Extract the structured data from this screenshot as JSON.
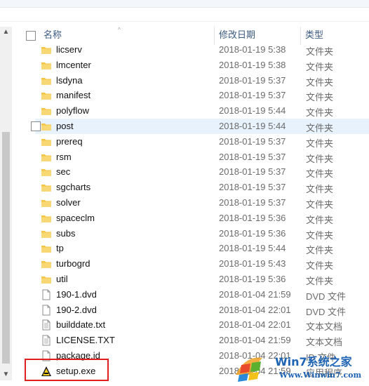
{
  "header": {
    "name": "名称",
    "date": "修改日期",
    "type": "类型"
  },
  "rows": [
    {
      "name": "licserv",
      "date": "2018-01-19 5:38",
      "type": "文件夹",
      "icon": "folder-icon"
    },
    {
      "name": "lmcenter",
      "date": "2018-01-19 5:38",
      "type": "文件夹",
      "icon": "folder-icon"
    },
    {
      "name": "lsdyna",
      "date": "2018-01-19 5:37",
      "type": "文件夹",
      "icon": "folder-icon"
    },
    {
      "name": "manifest",
      "date": "2018-01-19 5:37",
      "type": "文件夹",
      "icon": "folder-icon"
    },
    {
      "name": "polyflow",
      "date": "2018-01-19 5:44",
      "type": "文件夹",
      "icon": "folder-icon"
    },
    {
      "name": "post",
      "date": "2018-01-19 5:44",
      "type": "文件夹",
      "icon": "folder-icon",
      "hover": true
    },
    {
      "name": "prereq",
      "date": "2018-01-19 5:37",
      "type": "文件夹",
      "icon": "folder-icon"
    },
    {
      "name": "rsm",
      "date": "2018-01-19 5:37",
      "type": "文件夹",
      "icon": "folder-icon"
    },
    {
      "name": "sec",
      "date": "2018-01-19 5:37",
      "type": "文件夹",
      "icon": "folder-icon"
    },
    {
      "name": "sgcharts",
      "date": "2018-01-19 5:37",
      "type": "文件夹",
      "icon": "folder-icon"
    },
    {
      "name": "solver",
      "date": "2018-01-19 5:37",
      "type": "文件夹",
      "icon": "folder-icon"
    },
    {
      "name": "spaceclm",
      "date": "2018-01-19 5:36",
      "type": "文件夹",
      "icon": "folder-icon"
    },
    {
      "name": "subs",
      "date": "2018-01-19 5:36",
      "type": "文件夹",
      "icon": "folder-icon"
    },
    {
      "name": "tp",
      "date": "2018-01-19 5:44",
      "type": "文件夹",
      "icon": "folder-icon"
    },
    {
      "name": "turbogrd",
      "date": "2018-01-19 5:43",
      "type": "文件夹",
      "icon": "folder-icon"
    },
    {
      "name": "util",
      "date": "2018-01-19 5:36",
      "type": "文件夹",
      "icon": "folder-icon"
    },
    {
      "name": "190-1.dvd",
      "date": "2018-01-04 21:59",
      "type": "DVD 文件",
      "icon": "file-icon"
    },
    {
      "name": "190-2.dvd",
      "date": "2018-01-04 22:01",
      "type": "DVD 文件",
      "icon": "file-icon"
    },
    {
      "name": "builddate.txt",
      "date": "2018-01-04 22:01",
      "type": "文本文档",
      "icon": "text-file-icon"
    },
    {
      "name": "LICENSE.TXT",
      "date": "2018-01-04 21:59",
      "type": "文本文档",
      "icon": "text-file-icon"
    },
    {
      "name": "package.id",
      "date": "2018-01-04 22:01",
      "type": "ID 文件",
      "icon": "file-icon"
    },
    {
      "name": "setup.exe",
      "date": "2018-01-04 21:59",
      "type": "应用程序",
      "icon": "setup-app-icon"
    }
  ],
  "watermark": {
    "brand": "Win7系统之家",
    "url": "Www.Winwin7.com"
  },
  "colors": {
    "folder": "#f4c542",
    "header_text": "#3c5a80",
    "hover_row": "#e8f2fd",
    "highlight": "#e02020"
  }
}
